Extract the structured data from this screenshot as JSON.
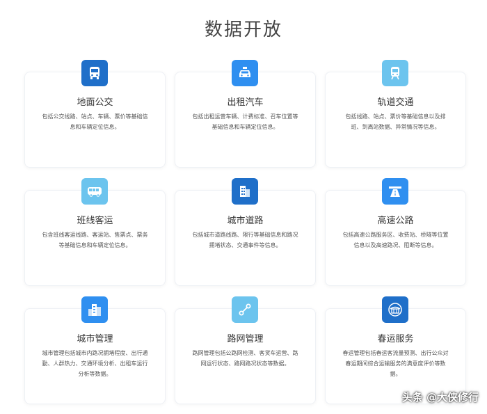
{
  "page_title": "数据开放",
  "cards": [
    {
      "title": "地面公交",
      "desc": "包括公交线路、站点、车辆、票价等基础信息和车辆定位信息。",
      "icon": "bus-icon",
      "color": "#1f6fc9"
    },
    {
      "title": "出租汽车",
      "desc": "包括出租运营车辆、计费标准、召车位置等基础信息和车辆定位信息。",
      "icon": "taxi-icon",
      "color": "#2f8ff0"
    },
    {
      "title": "轨道交通",
      "desc": "包括线路、站点、票价等基础信息以及排班、到离站数据、异常情况等信息。",
      "icon": "train-icon",
      "color": "#6cc4ee"
    },
    {
      "title": "班线客运",
      "desc": "包含班线客运线路、客运站、售票点、票务等基础信息和车辆定位信息。",
      "icon": "coach-bus-icon",
      "color": "#6cc4ee"
    },
    {
      "title": "城市道路",
      "desc": "包括城市道路线路、限行等基础信息和路况拥堵状态、交通事件等信息。",
      "icon": "city-building-icon",
      "color": "#1f6fc9"
    },
    {
      "title": "高速公路",
      "desc": "包括高速公路服务区、收费站、桥隧等位置信息以及高速路况、阻断等信息。",
      "icon": "highway-icon",
      "color": "#2f8ff0"
    },
    {
      "title": "城市管理",
      "desc": "城市管理包括城市内路况拥堵程度、出行通勤、人群热力、交通环境分析、出租车运行分析等数据。",
      "icon": "skyline-icon",
      "color": "#2f8ff0"
    },
    {
      "title": "路网管理",
      "desc": "路网管理包括公路网检测、客货车运营、路网运行状态、路网路况状态等数据。",
      "icon": "route-icon",
      "color": "#6cc4ee"
    },
    {
      "title": "春运服务",
      "desc": "春运管理包括春运客流量预测、出行公众对春运期间综合运输服务的满意度评价等数据。",
      "icon": "temple-icon",
      "color": "#1f6fc9"
    }
  ],
  "watermark": "头条 @大侠修行"
}
